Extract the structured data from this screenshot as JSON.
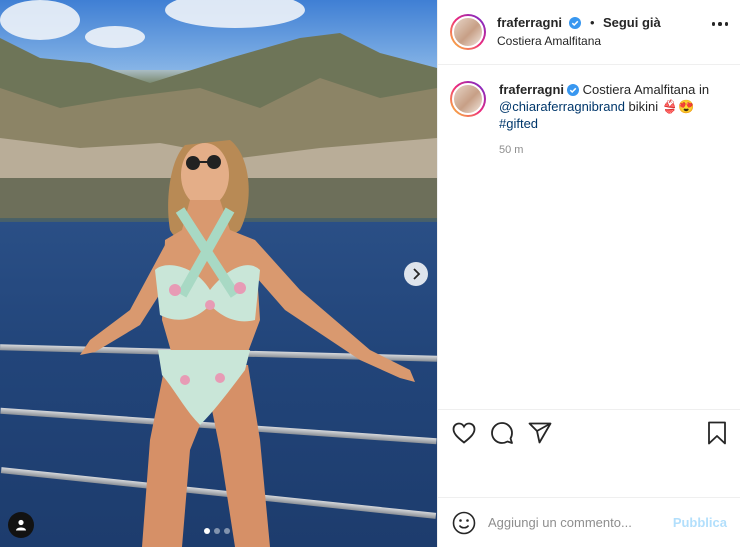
{
  "post": {
    "username": "fraferragni",
    "separator": "•",
    "follow_label": "Segui già",
    "location": "Costiera Amalfitana"
  },
  "caption": {
    "username": "fraferragni",
    "text_1": " Costiera Amalfitana in ",
    "mention": "@chiaraferragnibrand",
    "text_2": " bikini 👙😍",
    "hashtag": "#gifted",
    "time": "50 m"
  },
  "comment": {
    "placeholder": "Aggiungi un commento...",
    "publish_label": "Pubblica"
  },
  "carousel": {
    "slides": 3,
    "active": 1
  },
  "icons": {
    "verified": "verified-badge-icon",
    "more": "more-options-icon",
    "like": "heart-icon",
    "comment": "comment-bubble-icon",
    "share": "paper-plane-icon",
    "save": "bookmark-icon",
    "emoji": "smiley-icon",
    "next": "chevron-right-icon",
    "tag": "user-tag-icon"
  },
  "colors": {
    "verified": "#3897f0",
    "link": "#00376b",
    "publish_disabled": "#b2dffc",
    "muted": "#8e8e8e"
  }
}
